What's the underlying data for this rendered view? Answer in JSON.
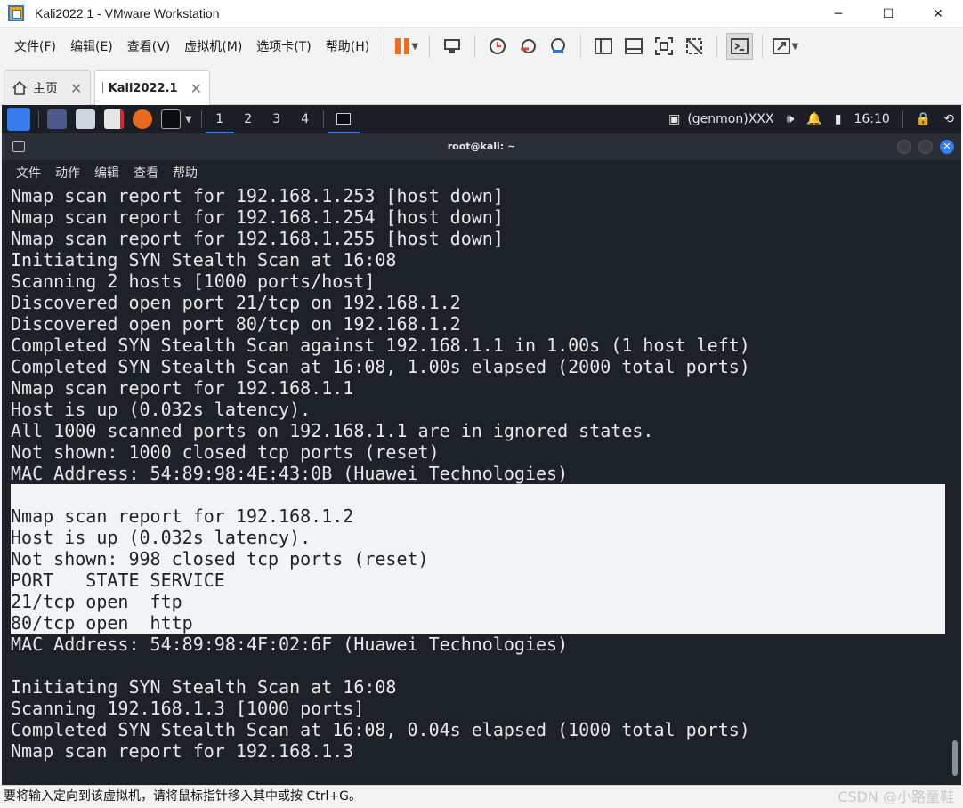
{
  "window": {
    "title": "Kali2022.1 - VMware Workstation",
    "min": "─",
    "max": "☐",
    "close": "✕"
  },
  "menu": [
    "文件(F)",
    "编辑(E)",
    "查看(V)",
    "虚拟机(M)",
    "选项卡(T)",
    "帮助(H)"
  ],
  "tabs": {
    "home": "主页",
    "vm": "Kali2022.1"
  },
  "kali_panel": {
    "workspaces": [
      "1",
      "2",
      "3",
      "4"
    ],
    "genmon": "(genmon)XXX",
    "time": "16:10"
  },
  "terminal": {
    "title": "root@kali: ~",
    "menu": [
      "文件",
      "动作",
      "编辑",
      "查看",
      "帮助"
    ],
    "lines": [
      "Nmap scan report for 192.168.1.253 [host down]",
      "Nmap scan report for 192.168.1.254 [host down]",
      "Nmap scan report for 192.168.1.255 [host down]",
      "Initiating SYN Stealth Scan at 16:08",
      "Scanning 2 hosts [1000 ports/host]",
      "Discovered open port 21/tcp on 192.168.1.2",
      "Discovered open port 80/tcp on 192.168.1.2",
      "Completed SYN Stealth Scan against 192.168.1.1 in 1.00s (1 host left)",
      "Completed SYN Stealth Scan at 16:08, 1.00s elapsed (2000 total ports)",
      "Nmap scan report for 192.168.1.1",
      "Host is up (0.032s latency).",
      "All 1000 scanned ports on 192.168.1.1 are in ignored states.",
      "Not shown: 1000 closed tcp ports (reset)",
      "MAC Address: 54:89:98:4E:43:0B (Huawei Technologies)"
    ],
    "selected_lines": [
      "",
      "Nmap scan report for 192.168.1.2",
      "Host is up (0.032s latency).",
      "Not shown: 998 closed tcp ports (reset)",
      "PORT   STATE SERVICE",
      "21/tcp open  ftp",
      "80/tcp open  http"
    ],
    "selected_last": "MAC Address: 54:89:98:4F:02:6F (Huawei Technologies)",
    "after_lines": [
      "",
      "Initiating SYN Stealth Scan at 16:08",
      "Scanning 192.168.1.3 [1000 ports]",
      "Completed SYN Stealth Scan at 16:08, 0.04s elapsed (1000 total ports)",
      "Nmap scan report for 192.168.1.3"
    ]
  },
  "status": {
    "text": "要将输入定向到该虚拟机，请将鼠标指针移入其中或按 Ctrl+G。",
    "watermark": "CSDN @小路童鞋"
  },
  "colors": {
    "kali_blue": "#367bf0",
    "pause_orange": "#f26b1d"
  }
}
